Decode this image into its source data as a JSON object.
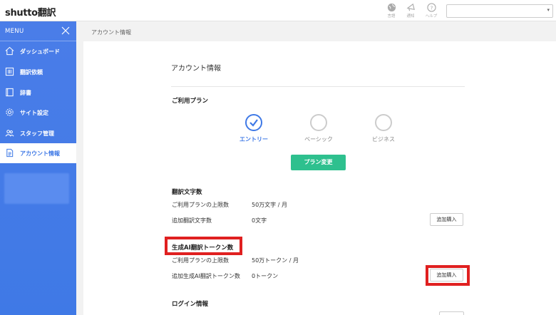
{
  "header": {
    "logo_main": "shutto",
    "logo_sub": "翻訳",
    "icons": [
      {
        "name": "globe-icon",
        "label": "言語"
      },
      {
        "name": "megaphone-icon",
        "label": "通知"
      },
      {
        "name": "help-icon",
        "label": "ヘルプ"
      }
    ],
    "lang_select_value": ""
  },
  "sidebar": {
    "menu_label": "MENU",
    "items": [
      {
        "label": "ダッシュボード",
        "icon": "home-icon"
      },
      {
        "label": "翻訳依頼",
        "icon": "grid-icon"
      },
      {
        "label": "辞書",
        "icon": "book-icon"
      },
      {
        "label": "サイト設定",
        "icon": "gear-icon"
      },
      {
        "label": "スタッフ管理",
        "icon": "staff-icon"
      },
      {
        "label": "アカウント情報",
        "icon": "document-icon",
        "active": true
      }
    ]
  },
  "breadcrumb": "アカウント情報",
  "main": {
    "title": "アカウント情報",
    "plan_section_title": "ご利用プラン",
    "plans": [
      {
        "label": "エントリー",
        "selected": true
      },
      {
        "label": "ベーシック",
        "selected": false
      },
      {
        "label": "ビジネス",
        "selected": false
      }
    ],
    "plan_change_label": "プラン変更",
    "char_section_title": "翻訳文字数",
    "char_rows": [
      {
        "label": "ご利用プランの上限数",
        "value": "50万文字 / 月"
      },
      {
        "label": "追加翻訳文字数",
        "value": "0文字",
        "button": "追加購入"
      }
    ],
    "token_section_title": "生成AI翻訳トークン数",
    "token_rows": [
      {
        "label": "ご利用プランの上限数",
        "value": "50万トークン / 月"
      },
      {
        "label": "追加生成AI翻訳トークン数",
        "value": "0トークン",
        "button": "追加購入"
      }
    ],
    "login_section_title": "ログイン情報"
  },
  "colors": {
    "sidebar": "#3f79e6",
    "accent": "#3f79e6",
    "plan_button": "#2ec08e",
    "highlight": "#e02020"
  }
}
